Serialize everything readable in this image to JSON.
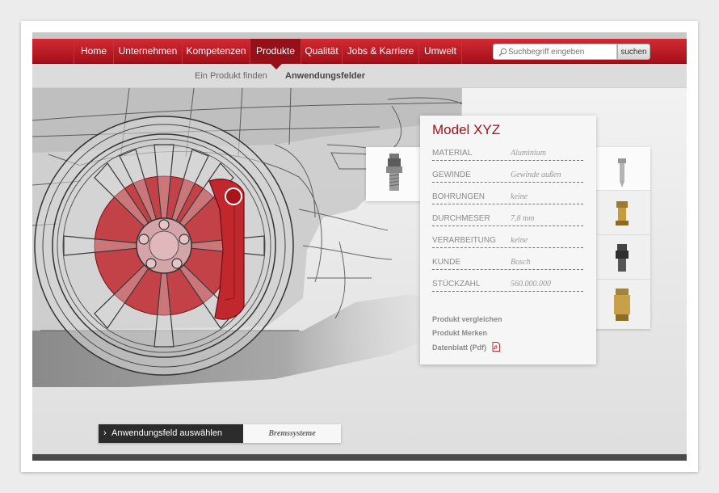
{
  "nav": {
    "items": [
      {
        "label": "Home"
      },
      {
        "label": "Unternehmen"
      },
      {
        "label": "Kompetenzen"
      },
      {
        "label": "Produkte"
      },
      {
        "label": "Qualität"
      },
      {
        "label": "Jobs & Karriere"
      },
      {
        "label": "Umwelt"
      }
    ],
    "active": "Produkte"
  },
  "search": {
    "placeholder": "Suchbegriff eingeben",
    "button_label": "suchen",
    "icon": "search-icon"
  },
  "subnav": {
    "items": [
      {
        "label": "Ein Produkt finden"
      },
      {
        "label": "Anwendungsfelder"
      }
    ],
    "active": "Anwendungsfelder"
  },
  "product": {
    "title": "Model XYZ",
    "specs": [
      {
        "key": "MATERIAL",
        "value": "Aluminium"
      },
      {
        "key": "GEWINDE",
        "value": "Gewinde außen"
      },
      {
        "key": "BOHRUNGEN",
        "value": "keine"
      },
      {
        "key": "DURCHMESER",
        "value": "7,8 mm"
      },
      {
        "key": "VERARBEITUNG",
        "value": "keine"
      },
      {
        "key": "KUNDE",
        "value": "Bosch"
      },
      {
        "key": "STÜCKZAHL",
        "value": "560.000.000"
      }
    ],
    "links": [
      {
        "label": "Produkt vergleichen"
      },
      {
        "label": "Produkt Merken"
      },
      {
        "label": "Datenblatt (Pdf)",
        "icon": "pdf-icon"
      }
    ]
  },
  "application": {
    "select_label": "Anwendungsfeld auswählen",
    "selected_value": "Bremssysteme"
  },
  "colors": {
    "brand_red": "#b51820",
    "highlight_red": "#c0282e",
    "dark_button": "#2c2c2c"
  }
}
